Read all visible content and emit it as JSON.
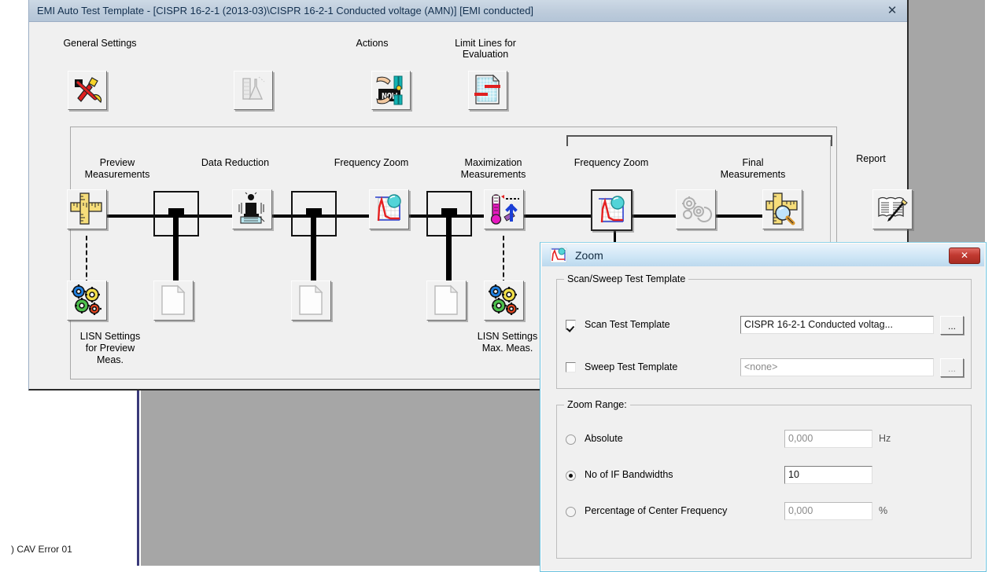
{
  "desktop": {
    "status_text": ") CAV Error 01"
  },
  "main_window": {
    "title": "EMI Auto Test Template - [CISPR 16-2-1 (2013-03)\\CISPR 16-2-1 Conducted voltage (AMN)] [EMI conducted]",
    "close_label": "✕",
    "toolbar": [
      {
        "label": "General Settings",
        "icon": "hammer-wrench-icon",
        "enabled": true
      },
      {
        "label": "",
        "icon": "flask-beaker-icon",
        "enabled": false
      },
      {
        "label": "Actions",
        "icon": "hands-now-icon",
        "enabled": true
      },
      {
        "label": "Limit Lines for\nEvaluation",
        "icon": "limit-lines-icon",
        "enabled": true
      }
    ],
    "flow": {
      "bracket_label": "",
      "steps": [
        {
          "label": "Preview\nMeasurements",
          "icon": "ruler-cross-icon"
        },
        {
          "label": "Data Reduction",
          "icon": "data-reduction-icon"
        },
        {
          "label": "Frequency Zoom",
          "icon": "freq-zoom-icon"
        },
        {
          "label": "Maximization\nMeasurements",
          "icon": "thermometer-arrow-icon"
        },
        {
          "label": "Frequency Zoom",
          "icon": "freq-zoom-icon",
          "selected": true
        },
        {
          "label": "",
          "icon": "gears-disabled-icon"
        },
        {
          "label": "Final\nMeasurements",
          "icon": "ruler-magnifier-icon"
        },
        {
          "label": "Report",
          "icon": "report-pen-icon"
        }
      ],
      "sub_steps": [
        {
          "label": "LISN Settings\nfor Preview\nMeas.",
          "icon": "gears-color-icon"
        },
        {
          "label": "LISN Settings\nMax. Meas.",
          "icon": "gears-color-icon"
        }
      ],
      "labels": {
        "preview_measurements": "Preview\nMeasurements",
        "data_reduction": "Data Reduction",
        "frequency_zoom_1": "Frequency Zoom",
        "maximization_measurements": "Maximization\nMeasurements",
        "frequency_zoom_2": "Frequency Zoom",
        "final_measurements": "Final\nMeasurements",
        "report": "Report",
        "lisn_preview": "LISN Settings\nfor Preview\nMeas.",
        "lisn_max": "LISN Settings\nMax. Meas."
      }
    }
  },
  "zoom_dialog": {
    "title": "Zoom",
    "close_label": "✕",
    "scan_sweep_group": {
      "title": "Scan/Sweep Test Template",
      "scan": {
        "label": "Scan Test Template",
        "checked": true,
        "value": "CISPR 16-2-1 Conducted voltag...",
        "browse_label": "..."
      },
      "sweep": {
        "label": "Sweep Test Template",
        "checked": false,
        "value": "<none>",
        "browse_label": "..."
      }
    },
    "zoom_range_group": {
      "title": "Zoom Range:",
      "options": [
        {
          "label": "Absolute",
          "selected": false,
          "value": "0,000",
          "unit": "Hz",
          "enabled": false
        },
        {
          "label": "No of IF Bandwidths",
          "selected": true,
          "value": "10",
          "unit": "",
          "enabled": true
        },
        {
          "label": "Percentage of Center Frequency",
          "selected": false,
          "value": "0,000",
          "unit": "%",
          "enabled": false
        }
      ]
    }
  }
}
